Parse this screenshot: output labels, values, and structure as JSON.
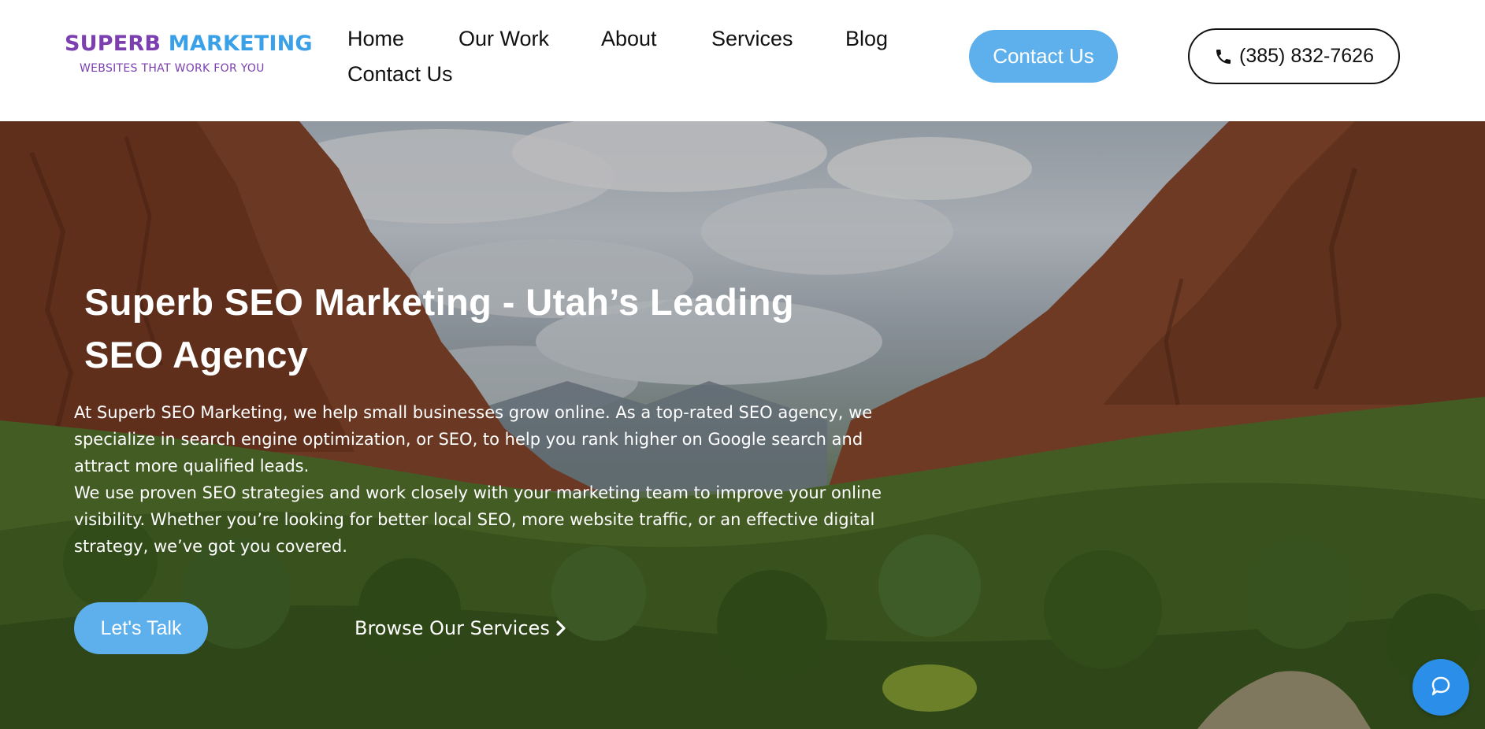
{
  "brand": {
    "name_part1": "SUPERB",
    "name_part2": "MARKETING",
    "tagline": "WEBSITES THAT WORK FOR YOU",
    "color_primary": "#7b3fb0",
    "color_secondary": "#3aa0e8"
  },
  "nav": {
    "items": [
      {
        "label": "Home"
      },
      {
        "label": "Our Work"
      },
      {
        "label": "About"
      },
      {
        "label": "Services"
      },
      {
        "label": "Blog"
      },
      {
        "label": "Contact Us"
      }
    ]
  },
  "header_actions": {
    "contact_label": "Contact Us",
    "phone_label": "(385) 832-7626",
    "phone_icon": "phone-icon",
    "accent_color": "#5eb0ec"
  },
  "hero": {
    "title": "Superb SEO Marketing - Utah’s Leading SEO Agency",
    "paragraph1": "At Superb SEO Marketing, we help small businesses grow online. As a top-rated SEO agency, we specialize in search engine optimization, or SEO, to help you rank higher on Google search and attract more qualified leads.",
    "paragraph2": "We use proven SEO strategies and work closely with your marketing team to improve your online visibility. Whether you’re looking for better local SEO, more website traffic, or an effective digital strategy, we’ve got you covered.",
    "cta_primary": "Let's Talk",
    "cta_secondary": "Browse Our Services",
    "cta_secondary_icon": "chevron-right-icon",
    "background": "canyon-landscape-image"
  },
  "chat_widget": {
    "icon": "chat-bubble-icon",
    "color": "#2b8fea"
  }
}
